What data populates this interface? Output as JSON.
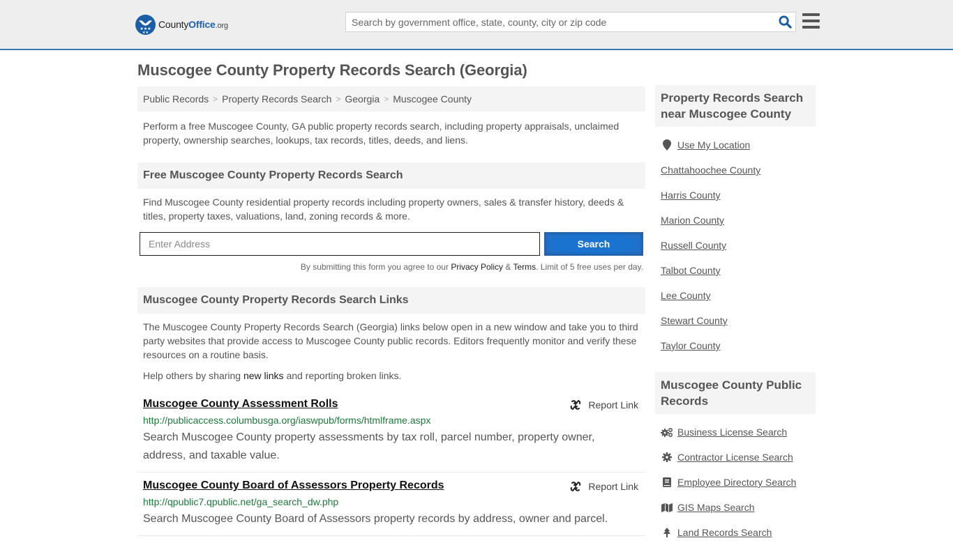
{
  "header": {
    "logo": {
      "name_part1": "County",
      "name_part2": "Office",
      "name_part3": ".org"
    },
    "search_placeholder": "Search by government office, state, county, city or zip code",
    "colors": {
      "brand_blue": "#1a5ea5",
      "border": "#3a77a8"
    }
  },
  "page": {
    "title": "Muscogee County Property Records Search (Georgia)",
    "breadcrumb": [
      "Public Records",
      "Property Records Search",
      "Georgia",
      "Muscogee County"
    ],
    "breadcrumb_sep": ">",
    "intro": "Perform a free Muscogee County, GA public property records search, including property appraisals, unclaimed property, ownership searches, lookups, tax records, titles, deeds, and liens."
  },
  "free_search": {
    "heading": "Free Muscogee County Property Records Search",
    "description": "Find Muscogee County residential property records including property owners, sales & transfer history, deeds & titles, property taxes, valuations, land, zoning records & more.",
    "address_placeholder": "Enter Address",
    "button_label": "Search",
    "disclaimer_pre": "By submitting this form you agree to our ",
    "privacy_label": "Privacy Policy",
    "amp": " & ",
    "terms_label": "Terms",
    "disclaimer_post": ". Limit of 5 free uses per day."
  },
  "links_section": {
    "heading": "Muscogee County Property Records Search Links",
    "intro": "The Muscogee County Property Records Search (Georgia) links below open in a new window and take you to third party websites that provide access to Muscogee County public records. Editors frequently monitor and verify these resources on a routine basis.",
    "help_pre": "Help others by sharing ",
    "help_link": "new links",
    "help_post": " and reporting broken links.",
    "report_label": "Report Link",
    "items": [
      {
        "title": "Muscogee County Assessment Rolls",
        "url": "http://publicaccess.columbusga.org/iaswpub/forms/htmlframe.aspx",
        "description": "Search Muscogee County property assessments by tax roll, parcel number, property owner, address, and taxable value."
      },
      {
        "title": "Muscogee County Board of Assessors Property Records",
        "url": "http://qpublic7.qpublic.net/ga_search_dw.php",
        "description": "Search Muscogee County Board of Assessors property records by address, owner and parcel."
      }
    ]
  },
  "sidebar": {
    "nearby_heading": "Property Records Search near Muscogee County",
    "use_location": "Use My Location",
    "nearby": [
      "Chattahoochee County",
      "Harris County",
      "Marion County",
      "Russell County",
      "Talbot County",
      "Lee County",
      "Stewart County",
      "Taylor County"
    ],
    "public_heading": "Muscogee County Public Records",
    "public": [
      {
        "label": "Business License Search",
        "icon": "cogs-icon"
      },
      {
        "label": "Contractor License Search",
        "icon": "gear-icon"
      },
      {
        "label": "Employee Directory Search",
        "icon": "book-icon"
      },
      {
        "label": "GIS Maps Search",
        "icon": "map-icon"
      },
      {
        "label": "Land Records Search",
        "icon": "tree-icon"
      }
    ]
  }
}
